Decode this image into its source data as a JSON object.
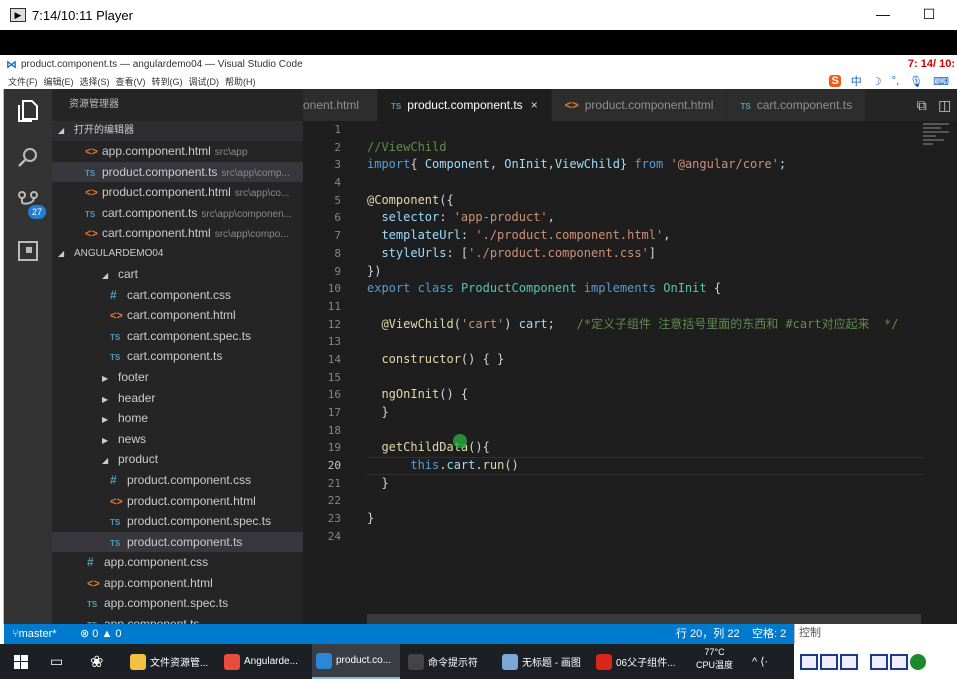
{
  "player": {
    "title": "7:14/10:11 Player",
    "minimize": "—",
    "maximize": "☐"
  },
  "vscode": {
    "window_title": "product.component.ts — angulardemo04 — Visual Studio Code",
    "overlay_time": "7: 14/ 10:",
    "menu": [
      "文件(F)",
      "编辑(E)",
      "选择(S)",
      "查看(V)",
      "转到(G)",
      "调试(D)",
      "帮助(H)"
    ],
    "ime": {
      "logo": "S",
      "mode": "中"
    },
    "activity": {
      "badge": "27"
    },
    "sidebar": {
      "title": "资源管理器",
      "open_editors_label": "打开的编辑器",
      "open_editors": [
        {
          "icon": "html",
          "name": "app.component.html",
          "path": "src\\app"
        },
        {
          "icon": "ts",
          "name": "product.component.ts",
          "path": "src\\app\\comp...",
          "selected": true
        },
        {
          "icon": "html",
          "name": "product.component.html",
          "path": "src\\app\\co..."
        },
        {
          "icon": "ts",
          "name": "cart.component.ts",
          "path": "src\\app\\componen..."
        },
        {
          "icon": "html",
          "name": "cart.component.html",
          "path": "src\\app\\compo..."
        }
      ],
      "project_label": "ANGULARDEMO04",
      "tree": [
        {
          "icon": "open",
          "name": "cart",
          "indent": 1
        },
        {
          "icon": "css",
          "name": "cart.component.css",
          "indent": 2
        },
        {
          "icon": "html",
          "name": "cart.component.html",
          "indent": 2
        },
        {
          "icon": "ts",
          "name": "cart.component.spec.ts",
          "indent": 2
        },
        {
          "icon": "ts",
          "name": "cart.component.ts",
          "indent": 2
        },
        {
          "icon": "closed",
          "name": "footer",
          "indent": 1
        },
        {
          "icon": "closed",
          "name": "header",
          "indent": 1
        },
        {
          "icon": "closed",
          "name": "home",
          "indent": 1
        },
        {
          "icon": "closed",
          "name": "news",
          "indent": 1
        },
        {
          "icon": "open",
          "name": "product",
          "indent": 1
        },
        {
          "icon": "css",
          "name": "product.component.css",
          "indent": 2
        },
        {
          "icon": "html",
          "name": "product.component.html",
          "indent": 2
        },
        {
          "icon": "ts",
          "name": "product.component.spec.ts",
          "indent": 2
        },
        {
          "icon": "ts",
          "name": "product.component.ts",
          "indent": 2,
          "selected": true
        },
        {
          "icon": "css",
          "name": "app.component.css",
          "indent": 0
        },
        {
          "icon": "html",
          "name": "app.component.html",
          "indent": 0
        },
        {
          "icon": "ts",
          "name": "app.component.spec.ts",
          "indent": 0
        },
        {
          "icon": "ts",
          "name": "app.component.ts",
          "indent": 0
        }
      ]
    },
    "tabs": [
      {
        "label": "onent.html",
        "icon": "",
        "active": false
      },
      {
        "label": "product.component.ts",
        "icon": "ts",
        "active": true,
        "close": "×"
      },
      {
        "label": "product.component.html",
        "icon": "html",
        "active": false
      },
      {
        "label": "cart.component.ts",
        "icon": "ts",
        "active": false
      }
    ],
    "code": [
      [],
      [
        [
          "c-com",
          "//ViewChild"
        ]
      ],
      [
        [
          "c-kw",
          "import"
        ],
        [
          "",
          "{ "
        ],
        [
          "c-var",
          "Component"
        ],
        [
          "",
          ", "
        ],
        [
          "c-var",
          "OnInit"
        ],
        [
          "",
          ","
        ],
        [
          "c-var",
          "ViewChild"
        ],
        [
          "",
          "} "
        ],
        [
          "c-kw",
          "from"
        ],
        [
          "c-str",
          " '@angular/core'"
        ],
        [
          "",
          ";"
        ]
      ],
      [],
      [
        [
          "c-fn",
          "@Component"
        ],
        [
          "",
          "({"
        ]
      ],
      [
        [
          "c-var",
          "  selector"
        ],
        [
          "",
          ": "
        ],
        [
          "c-str",
          "'app-product'"
        ],
        [
          "",
          ","
        ]
      ],
      [
        [
          "c-var",
          "  templateUrl"
        ],
        [
          "",
          ": "
        ],
        [
          "c-str",
          "'./product.component.html'"
        ],
        [
          "",
          ","
        ]
      ],
      [
        [
          "c-var",
          "  styleUrls"
        ],
        [
          "",
          ": ["
        ],
        [
          "c-str",
          "'./product.component.css'"
        ],
        [
          "",
          "]"
        ]
      ],
      [
        [
          "",
          "})"
        ]
      ],
      [
        [
          "c-kw",
          "export"
        ],
        [
          "c-kw",
          " class"
        ],
        [
          "c-cls",
          " ProductComponent"
        ],
        [
          "c-kw",
          " implements"
        ],
        [
          "c-cls",
          " OnInit"
        ],
        [
          "",
          " {"
        ]
      ],
      [],
      [
        [
          "c-fn",
          "  @ViewChild"
        ],
        [
          "",
          "("
        ],
        [
          "c-str",
          "'cart'"
        ],
        [
          "",
          ") "
        ],
        [
          "c-var",
          "cart"
        ],
        [
          "",
          ";   "
        ],
        [
          "c-com",
          "/*定义子组件 注意括号里面的东西和 #cart对应起来  */"
        ]
      ],
      [],
      [
        [
          "c-fn",
          "  constructor"
        ],
        [
          "",
          "() { }"
        ]
      ],
      [],
      [
        [
          "c-fn",
          "  ngOnInit"
        ],
        [
          "",
          "() {"
        ]
      ],
      [
        [
          "",
          "  }"
        ]
      ],
      [],
      [
        [
          "c-fn",
          "  getChildData"
        ],
        [
          "",
          "(){"
        ]
      ],
      [
        [
          "c-kw",
          "      this"
        ],
        [
          "",
          "."
        ],
        [
          "c-var",
          "cart"
        ],
        [
          "",
          "."
        ],
        [
          "c-fn",
          "run"
        ],
        [
          "",
          "()"
        ]
      ],
      [
        [
          "",
          "  }"
        ]
      ],
      [],
      [
        [
          "",
          "}"
        ]
      ],
      []
    ],
    "status": {
      "branch": "master*",
      "problems": "⊗ 0 ▲ 0",
      "position": "行 20，列 22",
      "spaces": "空格: 2"
    },
    "control_label": "控制"
  },
  "taskbar": {
    "items": [
      {
        "label": "文件资源管...",
        "color": "#f0c040"
      },
      {
        "label": "Angularde...",
        "color": "#e84c3c"
      },
      {
        "label": "product.co...",
        "color": "#2b88d8",
        "active": true
      },
      {
        "label": "命令提示符",
        "color": "#444444"
      },
      {
        "label": "无标题 - 画图",
        "color": "#7aa7d6"
      },
      {
        "label": "06父子组件...",
        "color": "#d9261c"
      }
    ],
    "temp": "77°C",
    "temp_label": "CPU温度"
  }
}
